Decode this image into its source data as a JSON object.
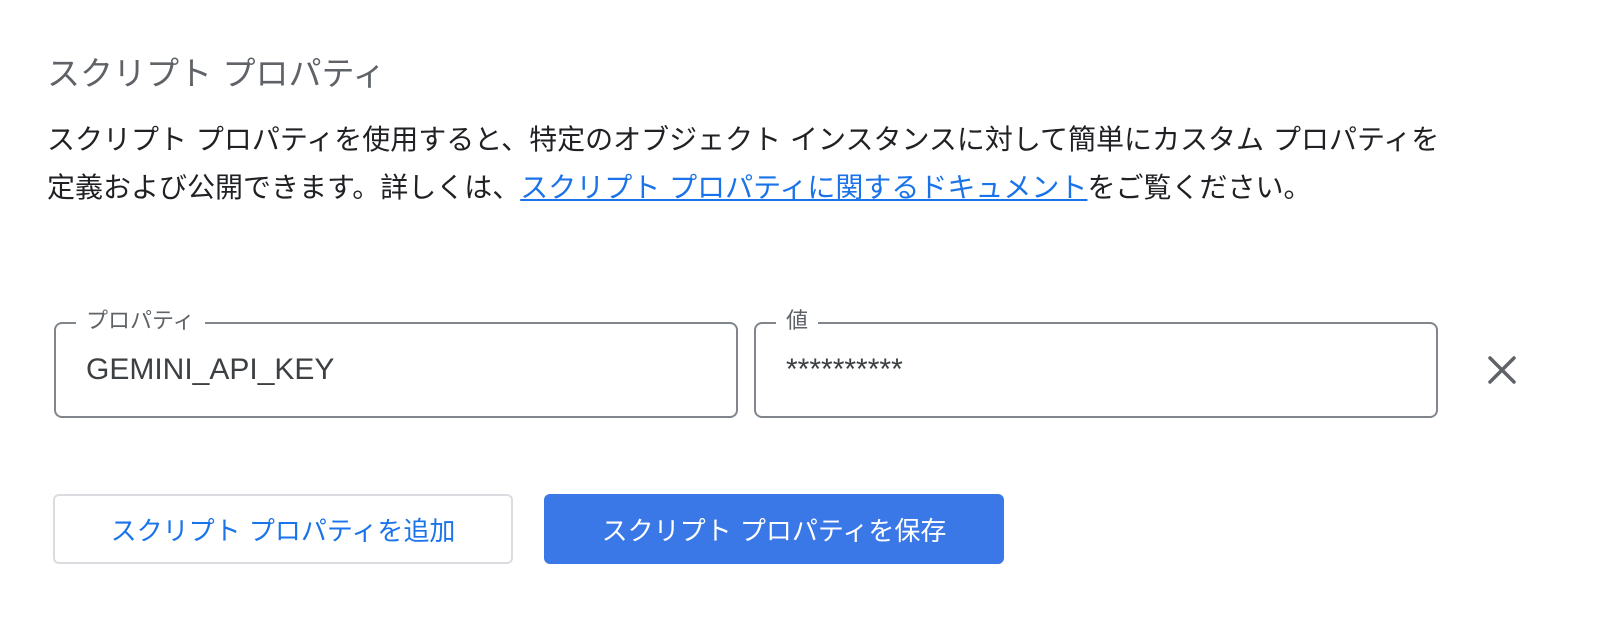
{
  "section": {
    "title": "スクリプト プロパティ",
    "description_before": "スクリプト プロパティを使用すると、特定のオブジェクト インスタンスに対して簡単にカスタム プロパティを定義および公開できます。詳しくは、",
    "description_link": "スクリプト プロパティに関するドキュメント",
    "description_after": "をご覧ください。"
  },
  "properties": [
    {
      "property_label": "プロパティ",
      "property_value": "GEMINI_API_KEY",
      "value_label": "値",
      "value_value": "**********"
    }
  ],
  "actions": {
    "add_label": "スクリプト プロパティを追加",
    "save_label": "スクリプト プロパティを保存"
  },
  "icons": {
    "delete": "close-icon"
  },
  "colors": {
    "primary": "#3b78e7",
    "link": "#1a73e8",
    "border": "#80868b",
    "muted": "#5f6368"
  }
}
